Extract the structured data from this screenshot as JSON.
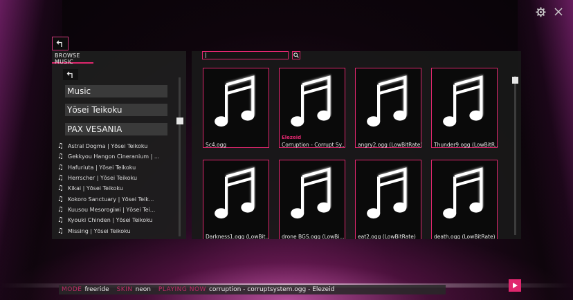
{
  "window": {
    "icons": [
      "gear-icon",
      "close-icon"
    ]
  },
  "browser": {
    "title": "BROWSE MUSIC",
    "folders": [
      "Music",
      "Yōsei Teikoku",
      "PAX VESANIA"
    ],
    "tracks": [
      "Astral Dogma | Yōsei Teikoku",
      "Gekkyou Hangon Cineranium | ...",
      "Hafuriuta | Yōsei Teikoku",
      "Herrscher | Yōsei Teikoku",
      "Kikai | Yōsei Teikoku",
      "Kokoro Sanctuary | Yōsei Teik...",
      "Kuusou Mesorogiwi | Yōsei Tei...",
      "Kyouki Chinden | Yōsei Teikoku",
      "Missing | Yōsei Teikoku"
    ]
  },
  "search": {
    "value": "|"
  },
  "files": [
    {
      "name": "Sc4.ogg",
      "tag": ""
    },
    {
      "name": "Corruption - Corrupt Sy...",
      "tag": "Elezeid"
    },
    {
      "name": "angry2.ogg (LowBitRate)",
      "tag": ""
    },
    {
      "name": "Thunder9.ogg (LowBitR...",
      "tag": ""
    },
    {
      "name": "Darkness1.ogg (LowBit...",
      "tag": ""
    },
    {
      "name": "drone BGS.ogg (LowBi...",
      "tag": ""
    },
    {
      "name": "eat2.ogg (LowBitRate)",
      "tag": ""
    },
    {
      "name": "death.ogg (LowBitRate)",
      "tag": ""
    }
  ],
  "status": {
    "mode_key": "MODE",
    "mode_value": "freeride",
    "skin_key": "SKIN",
    "skin_value": "neon",
    "playing_key": "PLAYING NOW",
    "playing_value": "corruption - corruptsystem.ogg - Elezeid"
  },
  "colors": {
    "accent": "#e0276e",
    "panel": "#1e1e1e"
  }
}
